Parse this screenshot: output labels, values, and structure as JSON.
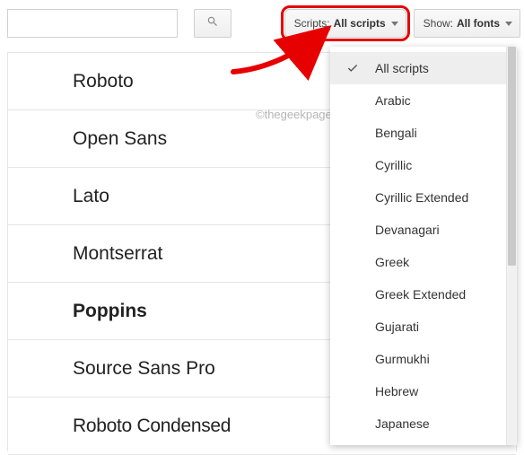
{
  "toolbar": {
    "search_placeholder": "",
    "scripts_label_prefix": "Scripts: ",
    "scripts_label_value": "All scripts",
    "show_label_prefix": "Show: ",
    "show_label_value": "All fonts"
  },
  "fonts": [
    "Roboto",
    "Open Sans",
    "Lato",
    "Montserrat",
    "Poppins",
    "Source Sans Pro",
    "Roboto Condensed"
  ],
  "scripts_menu": {
    "selected_index": 0,
    "items": [
      "All scripts",
      "Arabic",
      "Bengali",
      "Cyrillic",
      "Cyrillic Extended",
      "Devanagari",
      "Greek",
      "Greek Extended",
      "Gujarati",
      "Gurmukhi",
      "Hebrew",
      "Japanese"
    ]
  },
  "watermark": "©thegeekpage.com"
}
